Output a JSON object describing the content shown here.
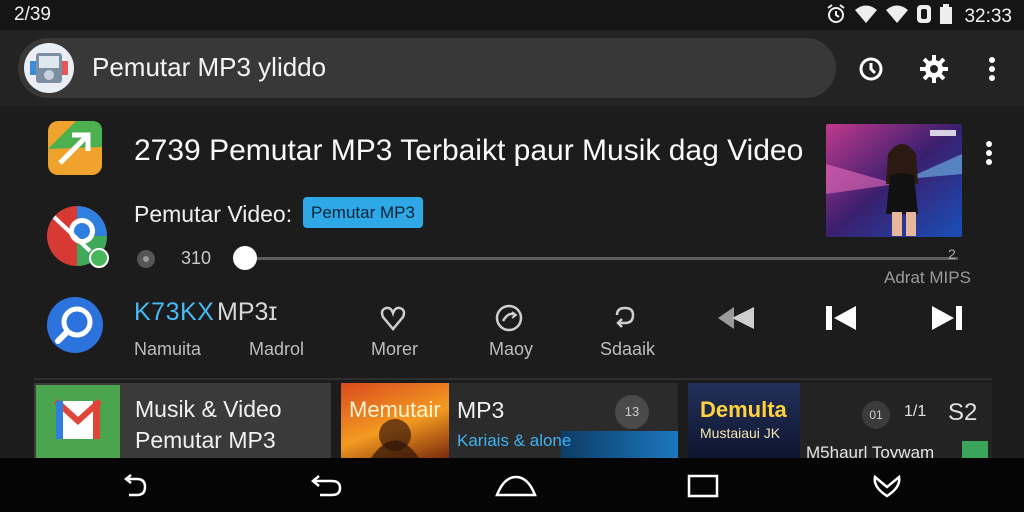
{
  "status_bar": {
    "left_text": "2/39",
    "time": "32:33",
    "icons": [
      "alarm-icon",
      "wifi-icon",
      "signal-icon",
      "data-icon",
      "battery-icon"
    ]
  },
  "app_bar": {
    "title": "Pemutar MP3 yliddo",
    "avatar_icon": "app-avatar-icon",
    "actions": [
      "timer-icon",
      "gear-icon",
      "more-vert-icon"
    ]
  },
  "now_playing": {
    "title": "2739 Pemutar MP3 Terbaikt paur Musik dag Video",
    "subtitle_label": "Pemutar Video:",
    "chip_label": "Pemutar MP3",
    "time_elapsed": "310",
    "time_total": "2",
    "progress": 0.0,
    "caption": "Adrat MIPS"
  },
  "controls": {
    "title_accent": "K73KX",
    "title_rest": "MP3ɪ",
    "labels": [
      "Namuita",
      "Madrol",
      "Morer",
      "Maoy",
      "Sdaaik"
    ],
    "icons": [
      "heart-icon",
      "shuffle-icon",
      "repeat-icon",
      "rewind-icon",
      "skip-previous-icon",
      "skip-next-icon"
    ]
  },
  "side_icons": [
    "app-shortcut-icon-orange",
    "app-shortcut-icon-red",
    "app-shortcut-icon-blue"
  ],
  "cards": [
    {
      "line1": "Musik & Video",
      "line2": "Pemutar MP3"
    },
    {
      "art_text": "Memutair",
      "title": "MP3",
      "subtitle": "Kariais & alone",
      "badge": "13"
    },
    {
      "art_text": "Demulta",
      "art_sub": "Mustaiaui JK",
      "subtitle": "M5haurl Toywam",
      "b1": "01",
      "b2": "1/1",
      "b3": "S2"
    }
  ],
  "nav_bar": {
    "icons": [
      "back-alt-icon",
      "back-icon",
      "home-icon",
      "recents-icon",
      "assistant-icon"
    ]
  },
  "colors": {
    "accent": "#2fa8e8",
    "background": "#1c1c1c",
    "pill": "#383838"
  }
}
